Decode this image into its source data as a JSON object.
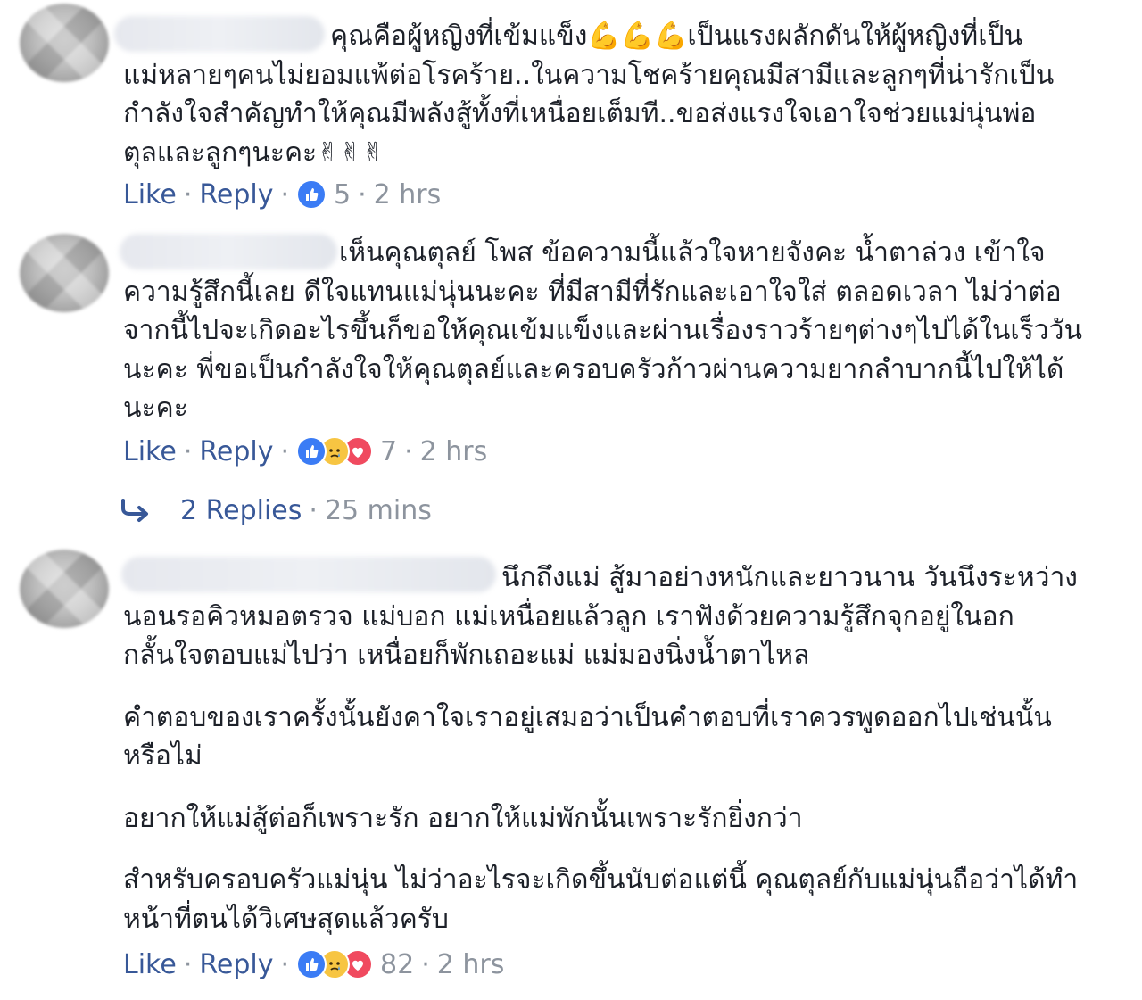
{
  "comments": [
    {
      "lines": [
        "คุณคือผู้หญิงที่เข้มแข็ง💪💪💪เป็นแรงผลักดันให้ผู้หญิงที่เป็น",
        "แม่หลายๆคนไม่ยอมแพ้ต่อโรคร้าย..ในความโชคร้ายคุณมีสามีและลูกๆที่น่ารักเป็น",
        "กำลังใจสำคัญทำให้คุณมีพลังสู้ทั้งที่เหนื่อยเต็มที..ขอส่งแรงใจเอาใจช่วยแม่นุ่นพ่อ",
        "ตุลและลูกๆนะคะ✌✌✌"
      ],
      "like_label": "Like",
      "reply_label": "Reply",
      "reaction_count": "5",
      "time": "2 hrs",
      "reactions": [
        "like"
      ]
    },
    {
      "lines": [
        "เห็นคุณตุลย์ โพส ข้อความนี้แล้วใจหายจังคะ น้ำตาล่วง เข้าใจ",
        "ความรู้สึกนี้เลย ดีใจแทนแม่นุ่นนะคะ ที่มีสามีที่รักและเอาใจใส่ ตลอดเวลา ไม่ว่าต่อ",
        "จากนี้ไปจะเกิดอะไรขึ้นก็ขอให้คุณเข้มแข็งและผ่านเรื่องราวร้ายๆต่างๆไปได้ในเร็ววัน",
        "นะคะ พี่ขอเป็นกำลังใจให้คุณตุลย์และครอบครัวก้าวผ่านความยากลำบากนี้ไปให้ได้",
        "นะคะ"
      ],
      "like_label": "Like",
      "reply_label": "Reply",
      "reaction_count": "7",
      "time": "2 hrs",
      "reactions": [
        "like",
        "sad",
        "love"
      ],
      "replies": {
        "label": "2 Replies",
        "time": "25 mins"
      }
    },
    {
      "paragraphs": [
        [
          "นึกถึงแม่ สู้มาอย่างหนักและยาวนาน วันนึงระหว่าง",
          "นอนรอคิวหมอตรวจ แม่บอก แม่เหนื่อยแล้วลูก เราฟังด้วยความรู้สึกจุกอยู่ในอก",
          "กลั้นใจตอบแม่ไปว่า เหนื่อยก็พักเถอะแม่ แม่มองนิ่งน้ำตาไหล"
        ],
        [
          "คำตอบของเราครั้งนั้นยังคาใจเราอยู่เสมอว่าเป็นคำตอบที่เราควรพูดออกไปเช่นนั้น",
          "หรือไม่"
        ],
        [
          "อยากให้แม่สู้ต่อก็เพราะรัก อยากให้แม่พักนั้นเพราะรักยิ่งกว่า"
        ],
        [
          "สำหรับครอบครัวแม่นุ่น ไม่ว่าอะไรจะเกิดขึ้นนับต่อแต่นี้ คุณตุลย์กับแม่นุ่นถือว่าได้ทำ",
          "หน้าที่ตนได้วิเศษสุดแล้วครับ"
        ]
      ],
      "like_label": "Like",
      "reply_label": "Reply",
      "reaction_count": "82",
      "time": "2 hrs",
      "reactions": [
        "like",
        "sad",
        "love"
      ]
    }
  ],
  "separator": "·",
  "icons": {
    "avatar": "blurred-avatar",
    "name": "blurred-name",
    "like": "like-reaction-icon",
    "sad": "sad-reaction-icon",
    "love": "love-reaction-icon",
    "reply_arrow": "reply-arrow-icon"
  },
  "colors": {
    "link": "#385898",
    "muted": "#8d949e",
    "text": "#1d2129",
    "like": "#3b7cf5",
    "love": "#f04a5f",
    "sad": "#f7c542"
  }
}
